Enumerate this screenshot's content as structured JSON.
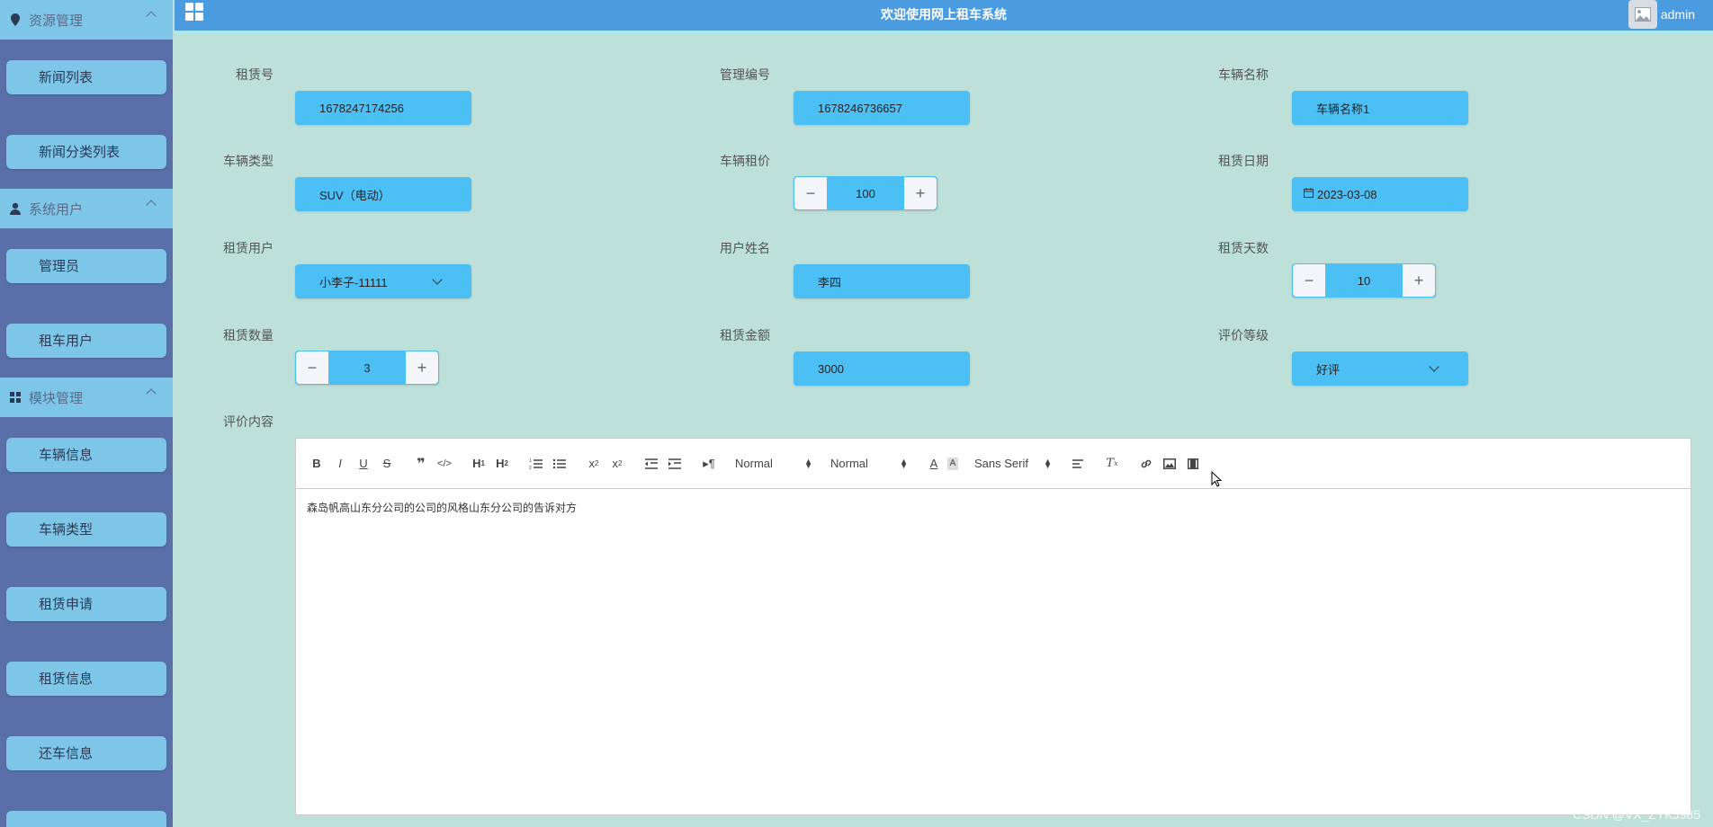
{
  "sidebar": {
    "groups": [
      {
        "label": "资源管理",
        "icon": "pin-icon"
      },
      {
        "label": "系统用户",
        "icon": "user-icon"
      },
      {
        "label": "模块管理",
        "icon": "grid-icon"
      }
    ],
    "items": {
      "news_list": "新闻列表",
      "news_category_list": "新闻分类列表",
      "admin": "管理员",
      "rental_user": "租车用户",
      "vehicle_info": "车辆信息",
      "vehicle_type": "车辆类型",
      "rental_apply": "租赁申请",
      "rental_info": "租赁信息",
      "return_info": "还车信息"
    }
  },
  "header": {
    "title": "欢迎使用网上租车系统",
    "user": "admin"
  },
  "form": {
    "rental_no": {
      "label": "租赁号",
      "value": "1678247174256"
    },
    "manage_no": {
      "label": "管理编号",
      "value": "1678246736657"
    },
    "vehicle_name": {
      "label": "车辆名称",
      "value": "车辆名称1"
    },
    "vehicle_type": {
      "label": "车辆类型",
      "value": "SUV（电动）"
    },
    "vehicle_price": {
      "label": "车辆租价",
      "value": "100"
    },
    "rental_date": {
      "label": "租赁日期",
      "value": "2023-03-08"
    },
    "rental_user": {
      "label": "租赁用户",
      "value": "小李子-11111"
    },
    "user_name": {
      "label": "用户姓名",
      "value": "李四"
    },
    "rental_days": {
      "label": "租赁天数",
      "value": "10"
    },
    "rental_qty": {
      "label": "租赁数量",
      "value": "3"
    },
    "rental_amount": {
      "label": "租赁金额",
      "value": "3000"
    },
    "rating": {
      "label": "评价等级",
      "value": "好评"
    },
    "review": {
      "label": "评价内容",
      "value": "森岛帆高山东分公司的公司的风格山东分公司的告诉对方"
    }
  },
  "editor_toolbar": {
    "header_select": "Normal",
    "size_select": "Normal",
    "font_select": "Sans Serif"
  },
  "stepper_symbols": {
    "minus": "−",
    "plus": "+"
  },
  "watermark": "CSDN @VX_ZYKJ985",
  "colors": {
    "sidebar_bg": "#5a6ea8",
    "sidebar_button": "#7dc6e8",
    "topbar": "#4a9be0",
    "content_bg": "#bde0d9",
    "field_bg": "#4cc0f5"
  }
}
